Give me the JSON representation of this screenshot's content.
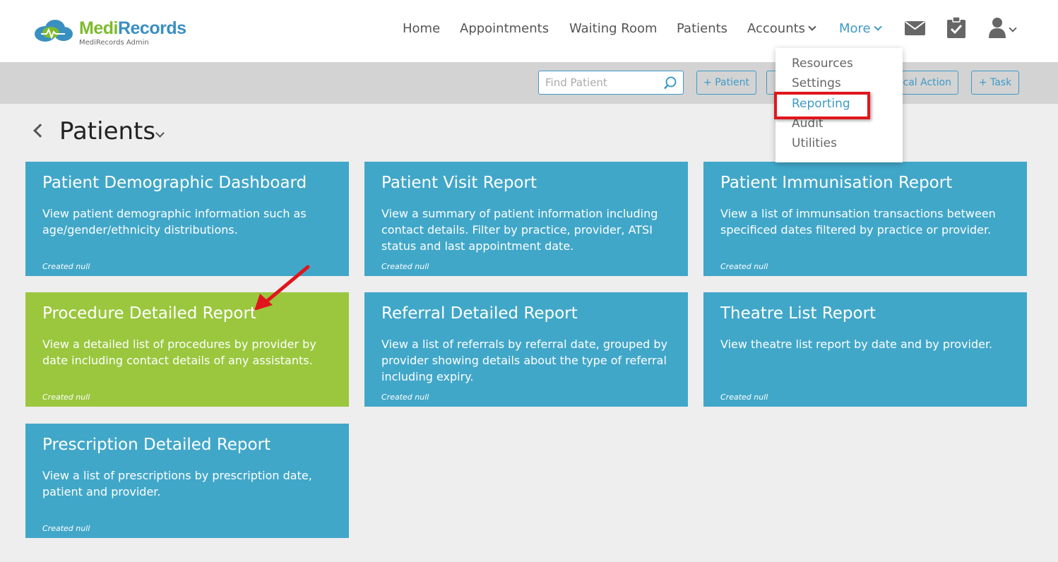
{
  "app": {
    "logo_medi": "Medi",
    "logo_records": "Records",
    "subtitle": "MediRecords Admin"
  },
  "nav": {
    "items": [
      {
        "label": "Home"
      },
      {
        "label": "Appointments"
      },
      {
        "label": "Waiting Room"
      },
      {
        "label": "Patients"
      },
      {
        "label": "Accounts"
      },
      {
        "label": "More"
      }
    ],
    "icons": [
      "mail-icon",
      "clipboard-check-icon",
      "user-icon"
    ]
  },
  "toolbar": {
    "search_placeholder": "Find Patient",
    "add_patient": "+ Patient",
    "clinical_action": "+ Clinical Action",
    "add_task": "+ Task"
  },
  "page": {
    "title": "Patients"
  },
  "more_menu": {
    "items": [
      "Resources",
      "Settings",
      "Reporting",
      "Audit",
      "Utilities"
    ],
    "active": "Reporting"
  },
  "cards": [
    {
      "title": "Patient Demographic Dashboard",
      "desc": "View patient demographic information such as age/gender/ethnicity distributions.",
      "foot": "Created null"
    },
    {
      "title": "Patient Visit Report",
      "desc": "View a summary of patient information including contact details. Filter by practice, provider, ATSI status and last appointment date.",
      "foot": "Created null"
    },
    {
      "title": "Patient Immunisation Report",
      "desc": "View a list of immunsation transactions between specificed dates filtered by practice or provider.",
      "foot": "Created null"
    },
    {
      "title": "Procedure Detailed Report",
      "desc": "View a detailed list of procedures by provider by date including contact details of any assistants.",
      "foot": "Created null"
    },
    {
      "title": "Referral Detailed Report",
      "desc": "View a list of referrals by referral date, grouped by provider showing details about the type of referral including expiry.",
      "foot": "Created null"
    },
    {
      "title": "Theatre List Report",
      "desc": "View theatre list report by date and by provider.",
      "foot": "Created null"
    },
    {
      "title": "Prescription Detailed Report",
      "desc": "View a list of prescriptions by prescription date, patient and provider.",
      "foot": "Created null"
    }
  ],
  "colors": {
    "card_blue": "#41a7c9",
    "card_green": "#9ac73e",
    "accent": "#3e9ac9",
    "highlight": "#e0161d"
  }
}
